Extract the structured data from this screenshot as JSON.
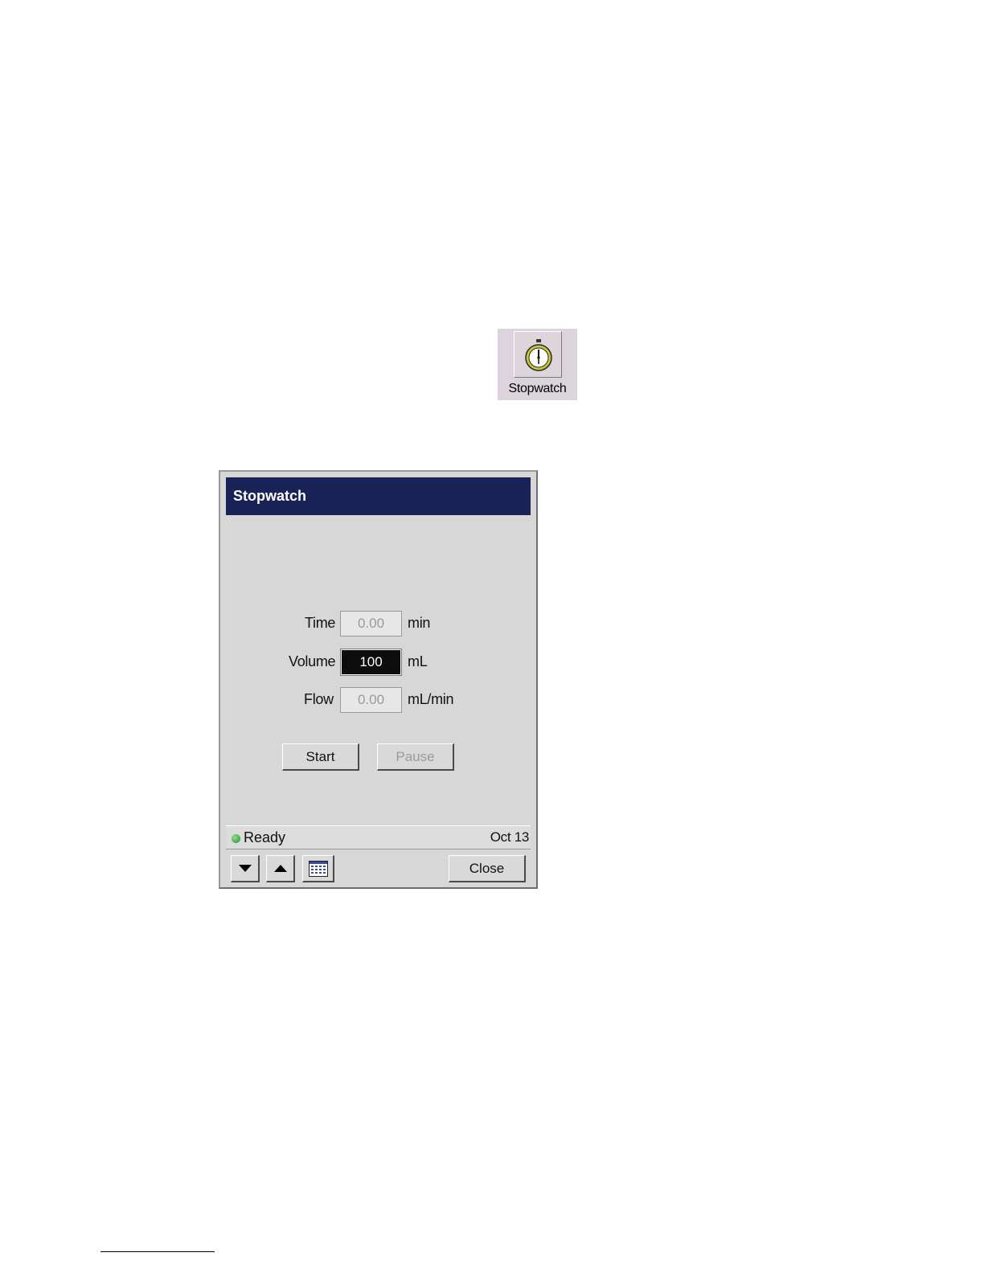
{
  "launcher": {
    "label": "Stopwatch",
    "icon": "stopwatch-icon"
  },
  "window": {
    "title": "Stopwatch",
    "fields": [
      {
        "label": "Time",
        "value": "0.00",
        "unit": "min",
        "active": false
      },
      {
        "label": "Volume",
        "value": "100",
        "unit": "mL",
        "active": true
      },
      {
        "label": "Flow",
        "value": "0.00",
        "unit": "mL/min",
        "active": false
      }
    ],
    "buttons": {
      "start": "Start",
      "pause": "Pause",
      "close": "Close"
    },
    "status": {
      "text": "Ready",
      "date": "Oct 13",
      "indicator_color": "#2e9e2e"
    },
    "toolbar_icons": [
      "arrow-down-icon",
      "arrow-up-icon",
      "keypad-icon"
    ]
  },
  "colors": {
    "titlebar": "#1a2357",
    "window_bg": "#d7d7d7"
  }
}
